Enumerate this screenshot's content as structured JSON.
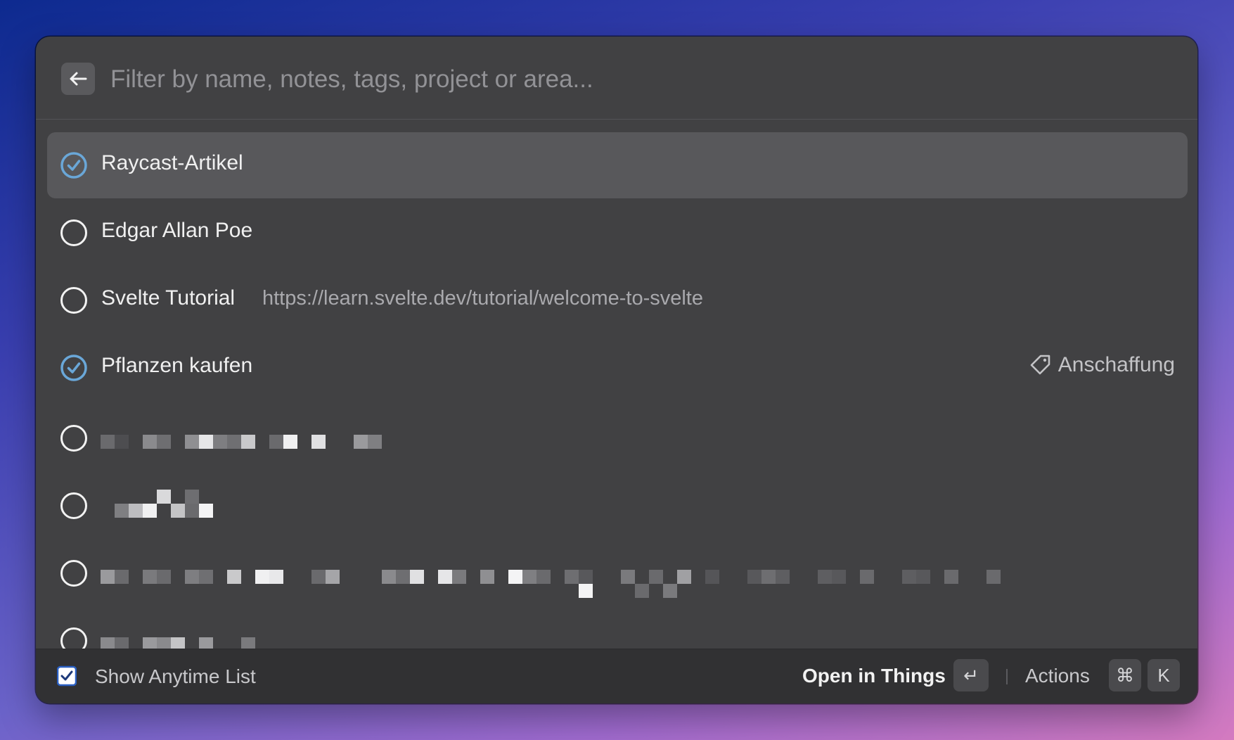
{
  "search": {
    "placeholder": "Filter by name, notes, tags, project or area...",
    "back_icon": "arrow-left-icon"
  },
  "items": [
    {
      "title": "Raycast-Artikel",
      "status": "checked",
      "selected": true
    },
    {
      "title": "Edgar Allan Poe",
      "status": "open"
    },
    {
      "title": "Svelte Tutorial",
      "subtitle": "https://learn.svelte.dev/tutorial/welcome-to-svelte",
      "status": "open"
    },
    {
      "title": "Pflanzen kaufen",
      "status": "checked",
      "tag": "Anschaffung",
      "tag_icon": "tag-icon"
    },
    {
      "title": "",
      "status": "open",
      "pixelated": true
    },
    {
      "title": "",
      "status": "open",
      "pixelated": true
    },
    {
      "title": "",
      "status": "open",
      "pixelated": true
    },
    {
      "title": "",
      "status": "open",
      "pixelated": true
    }
  ],
  "footer": {
    "checkbox_checked": true,
    "anytime_label": "Show Anytime List",
    "primary_action": "Open in Things",
    "enter_key": "↵",
    "actions_label": "Actions",
    "cmd_key": "⌘",
    "k_key": "K"
  },
  "colors": {
    "window_bg": "#414143",
    "selected_row": "#58585b",
    "check_blue": "#6aa7d8",
    "footer_bg": "#313133"
  }
}
